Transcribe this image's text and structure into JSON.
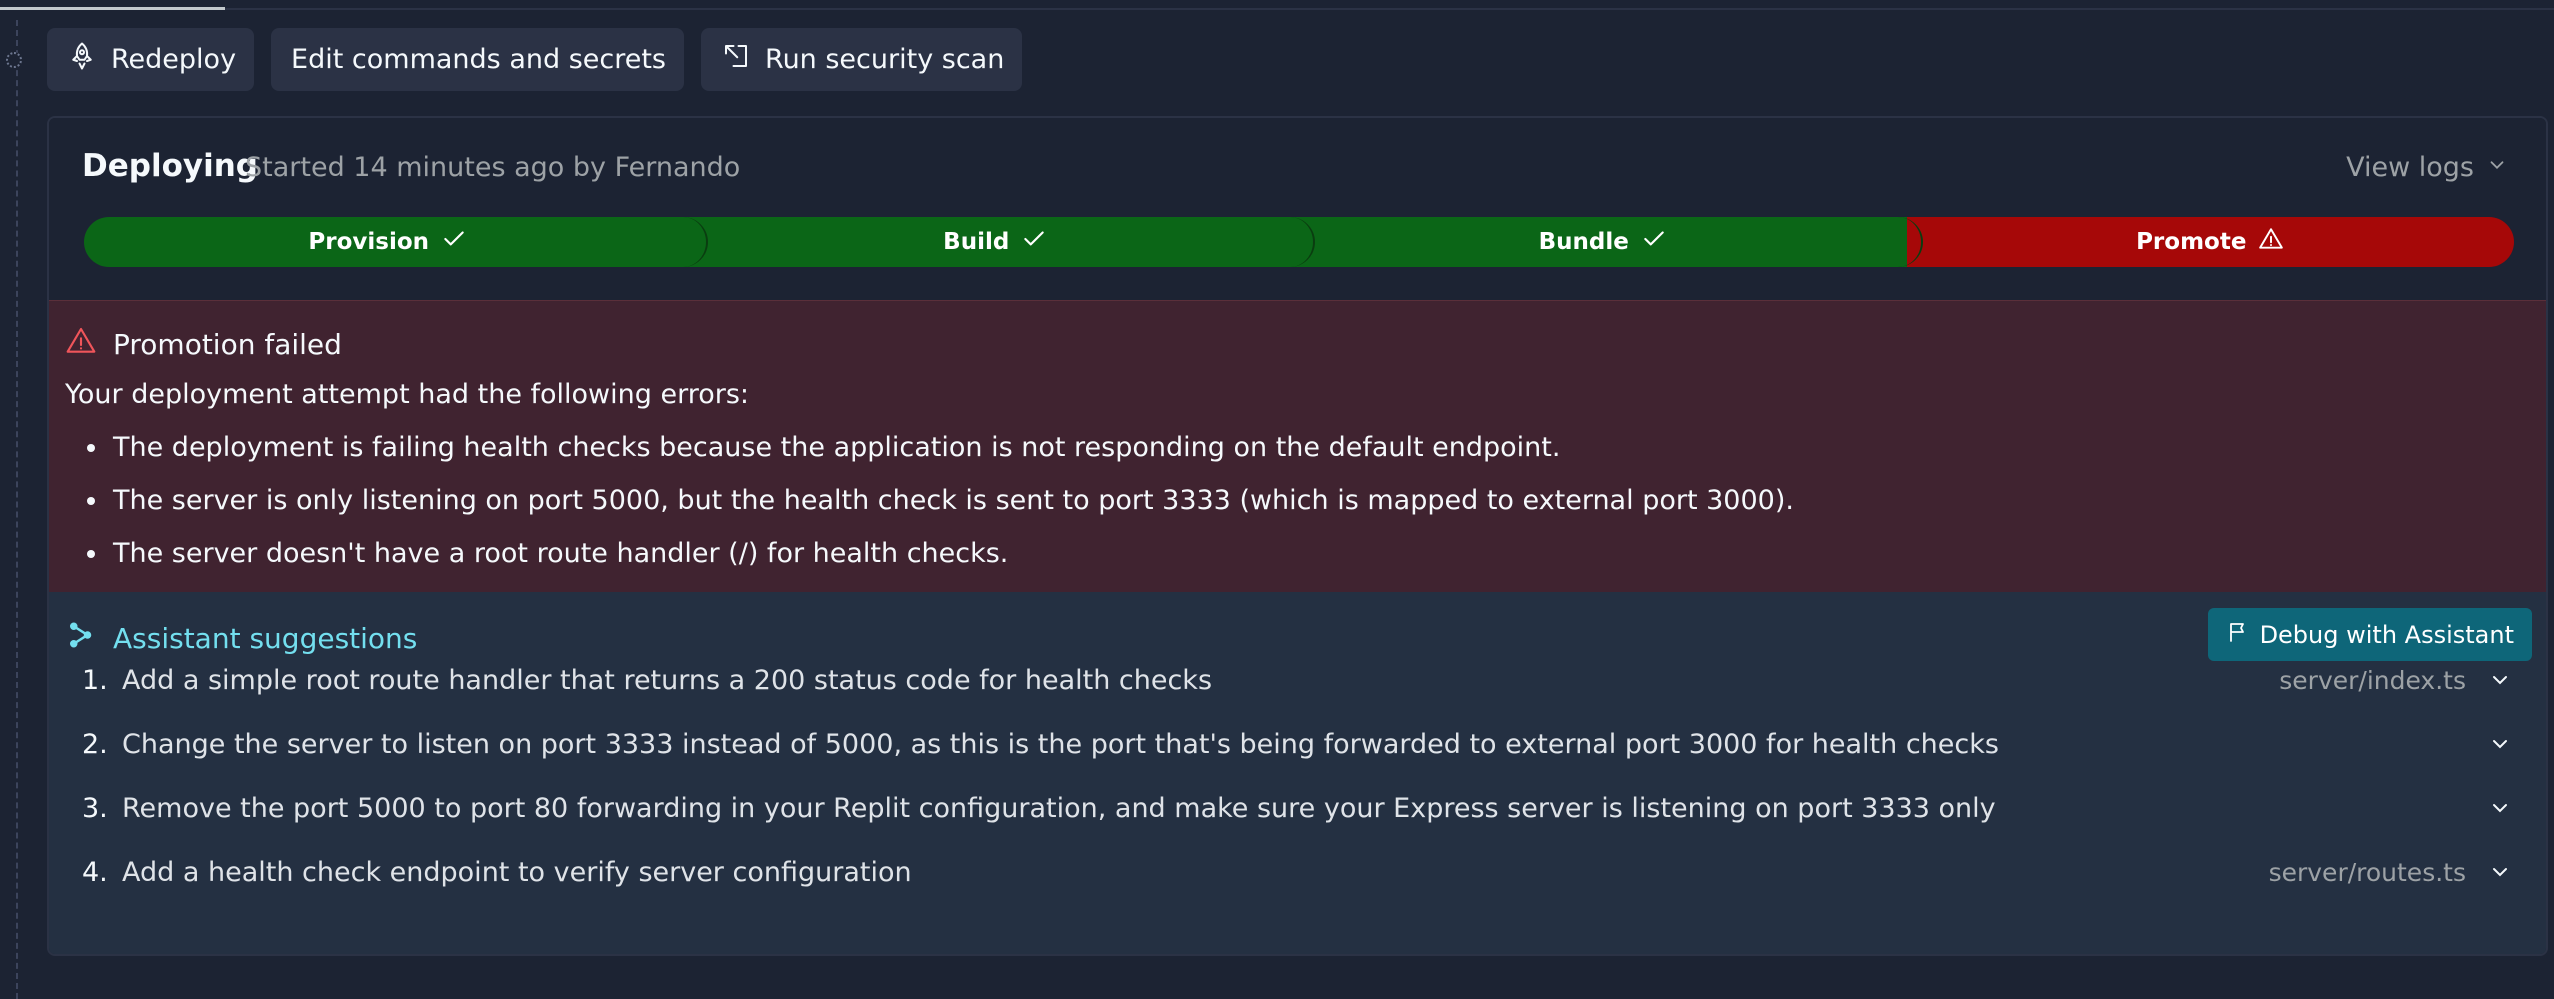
{
  "actions": {
    "redeploy_label": "Redeploy",
    "edit_label": "Edit commands and secrets",
    "scan_label": "Run security scan"
  },
  "deployment": {
    "status": "Deploying",
    "subtitle": "Started 14 minutes ago by Fernando",
    "view_logs": "View logs",
    "steps": [
      {
        "label": "Provision",
        "state": "success"
      },
      {
        "label": "Build",
        "state": "success"
      },
      {
        "label": "Bundle",
        "state": "success"
      },
      {
        "label": "Promote",
        "state": "failed"
      }
    ]
  },
  "error": {
    "title": "Promotion failed",
    "intro": "Your deployment attempt had the following errors:",
    "items": [
      "The deployment is failing health checks because the application is not responding on the default endpoint.",
      "The server is only listening on port 5000, but the health check is sent to port 3333 (which is mapped to external port 3000).",
      "The server doesn't have a root route handler (/) for health checks."
    ]
  },
  "assistant": {
    "title": "Assistant suggestions",
    "debug_label": "Debug with Assistant",
    "suggestions": [
      {
        "num": "1.",
        "text": "Add a simple root route handler that returns a 200 status code for health checks",
        "file": "server/index.ts"
      },
      {
        "num": "2.",
        "text": "Change the server to listen on port 3333 instead of 5000, as this is the port that's being forwarded to external port 3000 for health checks",
        "file": ""
      },
      {
        "num": "3.",
        "text": "Remove the port 5000 to port 80 forwarding in your Replit configuration, and make sure your Express server is listening on port 3333 only",
        "file": ""
      },
      {
        "num": "4.",
        "text": "Add a health check endpoint to verify server configuration",
        "file": "server/routes.ts"
      }
    ]
  },
  "colors": {
    "background": "#1c2333",
    "success": "#0b6617",
    "failure": "#a60808",
    "error_bg": "#402330",
    "assistant_accent": "#73dfef",
    "debug_button": "#0e6679"
  }
}
